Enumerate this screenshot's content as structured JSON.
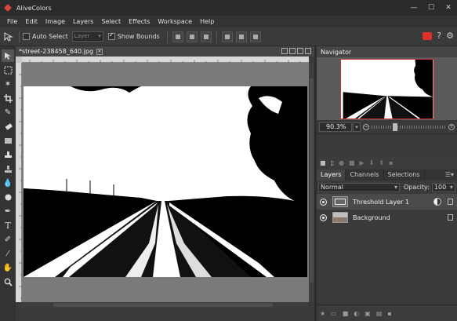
{
  "app": {
    "title": "AliveColors"
  },
  "window_controls": {
    "minimize": "—",
    "maximize": "☐",
    "close": "✕"
  },
  "menu": [
    "File",
    "Edit",
    "Image",
    "Layers",
    "Select",
    "Effects",
    "Workspace",
    "Help"
  ],
  "options": {
    "auto_select_label": "Auto Select",
    "auto_select_checked": false,
    "layer_dropdown": "Layer",
    "show_bounds_label": "Show Bounds",
    "show_bounds_checked": true
  },
  "document": {
    "tab_title": "*street-238458_640.jpg"
  },
  "navigator": {
    "title": "Navigator",
    "zoom": "90.3%",
    "zoom_level": 0.3
  },
  "layers_panel": {
    "tabs": [
      "Layers",
      "Channels",
      "Selections"
    ],
    "active_tab": "Layers",
    "blend_mode": "Normal",
    "opacity_label": "Opacity:",
    "opacity_value": "100",
    "layers": [
      {
        "name": "Threshold Layer 1",
        "type": "adjustment",
        "visible": true,
        "selected": true
      },
      {
        "name": "Background",
        "type": "image",
        "visible": true,
        "selected": false
      }
    ]
  },
  "colors": {
    "accent_red": "#e0302a",
    "panel_bg": "#3a3a3a"
  },
  "icons": {
    "tools": [
      "move-icon",
      "marquee-icon",
      "magic-wand-icon",
      "crop-icon",
      "brush-icon",
      "eraser-icon",
      "gradient-icon",
      "clone-stamp-icon",
      "stamp-icon",
      "blur-icon",
      "dodge-icon",
      "pen-icon",
      "text-icon",
      "path-select-icon",
      "eyedropper-icon",
      "hand-icon",
      "zoom-icon"
    ]
  }
}
